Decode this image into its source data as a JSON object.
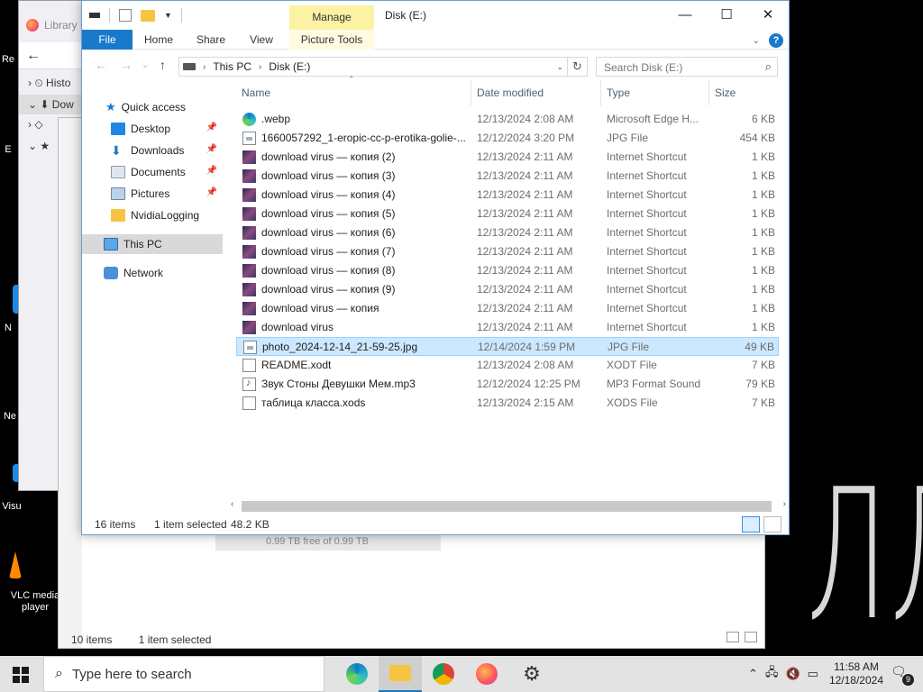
{
  "background_windows": {
    "library_title": "Library",
    "library_items": [
      "Histo",
      "Dow"
    ],
    "back_explorer": {
      "drive_free": "0.99 TB free of 0.99 TB",
      "status_items": "10 items",
      "status_selected": "1 item selected"
    }
  },
  "desktop": {
    "icons": [
      "Re",
      "E",
      "N",
      "Ne",
      "Visu",
      "VLC media player"
    ],
    "wallpaper_text": "ЛЛ"
  },
  "window": {
    "title": "Disk (E:)",
    "manage_tab": "Manage",
    "ribbon_tabs": [
      "File",
      "Home",
      "Share",
      "View",
      "Picture Tools"
    ],
    "help": "?",
    "address": {
      "crumbs": [
        "This PC",
        "Disk (E:)"
      ]
    },
    "search_placeholder": "Search Disk (E:)",
    "nav": {
      "quick_access": "Quick access",
      "items": [
        {
          "label": "Desktop",
          "icon": "desktop-icon",
          "pinned": true
        },
        {
          "label": "Downloads",
          "icon": "download-icon",
          "pinned": true
        },
        {
          "label": "Documents",
          "icon": "documents-icon",
          "pinned": true
        },
        {
          "label": "Pictures",
          "icon": "pictures-icon",
          "pinned": true
        },
        {
          "label": "NvidiaLogging",
          "icon": "folder-icon",
          "pinned": false
        }
      ],
      "this_pc": "This PC",
      "network": "Network"
    },
    "columns": {
      "name": "Name",
      "date": "Date modified",
      "type": "Type",
      "size": "Size"
    },
    "files": [
      {
        "name": ".webp",
        "date": "12/13/2024 2:08 AM",
        "type": "Microsoft Edge H...",
        "size": "6 KB",
        "icon": "edge"
      },
      {
        "name": "1660057292_1-eropic-cc-p-erotika-golie-...",
        "date": "12/12/2024 3:20 PM",
        "type": "JPG File",
        "size": "454 KB",
        "icon": "jpg"
      },
      {
        "name": "download virus — копия (2)",
        "date": "12/13/2024 2:11 AM",
        "type": "Internet Shortcut",
        "size": "1 KB",
        "icon": "url"
      },
      {
        "name": "download virus — копия (3)",
        "date": "12/13/2024 2:11 AM",
        "type": "Internet Shortcut",
        "size": "1 KB",
        "icon": "url"
      },
      {
        "name": "download virus — копия (4)",
        "date": "12/13/2024 2:11 AM",
        "type": "Internet Shortcut",
        "size": "1 KB",
        "icon": "url"
      },
      {
        "name": "download virus — копия (5)",
        "date": "12/13/2024 2:11 AM",
        "type": "Internet Shortcut",
        "size": "1 KB",
        "icon": "url"
      },
      {
        "name": "download virus — копия (6)",
        "date": "12/13/2024 2:11 AM",
        "type": "Internet Shortcut",
        "size": "1 KB",
        "icon": "url"
      },
      {
        "name": "download virus — копия (7)",
        "date": "12/13/2024 2:11 AM",
        "type": "Internet Shortcut",
        "size": "1 KB",
        "icon": "url"
      },
      {
        "name": "download virus — копия (8)",
        "date": "12/13/2024 2:11 AM",
        "type": "Internet Shortcut",
        "size": "1 KB",
        "icon": "url"
      },
      {
        "name": "download virus — копия (9)",
        "date": "12/13/2024 2:11 AM",
        "type": "Internet Shortcut",
        "size": "1 KB",
        "icon": "url"
      },
      {
        "name": "download virus — копия",
        "date": "12/13/2024 2:11 AM",
        "type": "Internet Shortcut",
        "size": "1 KB",
        "icon": "url"
      },
      {
        "name": "download virus",
        "date": "12/13/2024 2:11 AM",
        "type": "Internet Shortcut",
        "size": "1 KB",
        "icon": "url"
      },
      {
        "name": "photo_2024-12-14_21-59-25.jpg",
        "date": "12/14/2024 1:59 PM",
        "type": "JPG File",
        "size": "49 KB",
        "icon": "jpg",
        "selected": true
      },
      {
        "name": "README.xodt",
        "date": "12/13/2024 2:08 AM",
        "type": "XODT File",
        "size": "7 KB",
        "icon": "doc"
      },
      {
        "name": "Звук Стоны Девушки Мем.mp3",
        "date": "12/12/2024 12:25 PM",
        "type": "MP3 Format Sound",
        "size": "79 KB",
        "icon": "mp3"
      },
      {
        "name": "таблица класса.xods",
        "date": "12/13/2024 2:15 AM",
        "type": "XODS File",
        "size": "7 KB",
        "icon": "doc"
      }
    ],
    "status": {
      "count": "16 items",
      "selected": "1 item selected",
      "size": "48.2 KB"
    }
  },
  "taskbar": {
    "search_placeholder": "Type here to search",
    "apps": [
      "edge",
      "file-explorer",
      "chrome",
      "firefox",
      "settings"
    ],
    "time": "11:58 AM",
    "date": "12/18/2024",
    "notifications": "9"
  }
}
